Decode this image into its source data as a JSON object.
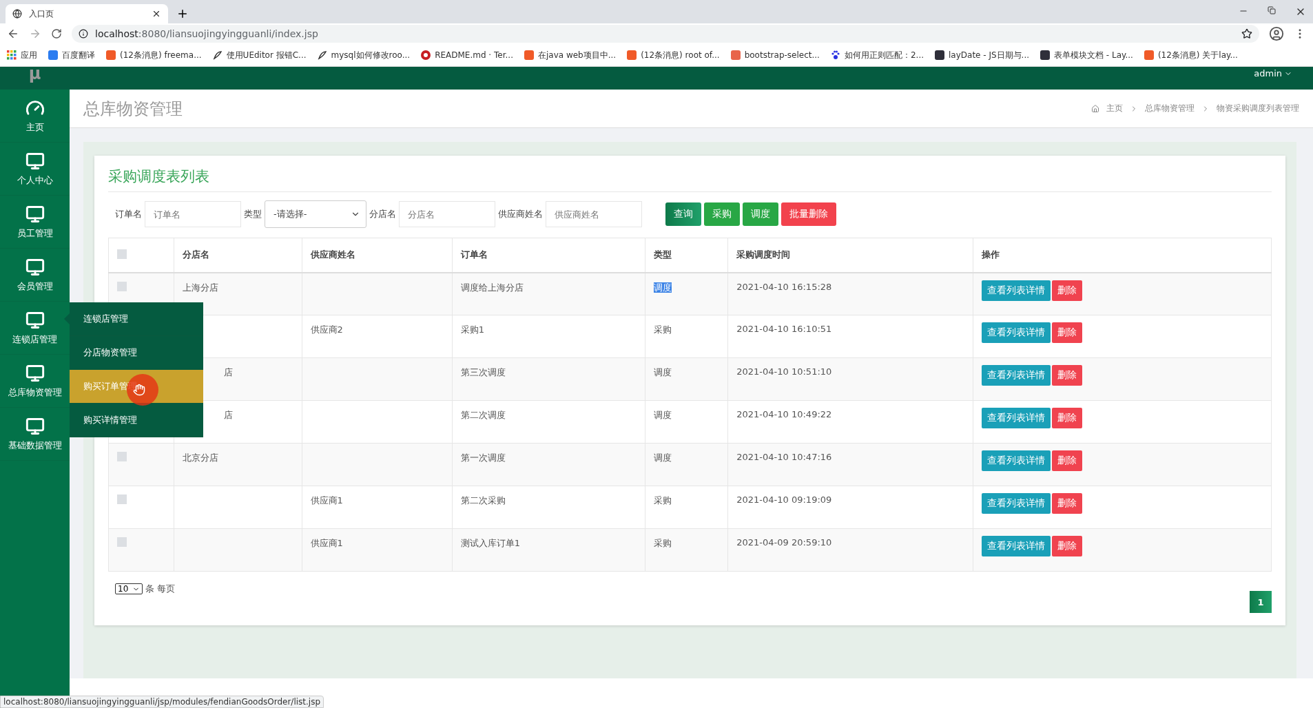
{
  "browser": {
    "tab_title": "入口页",
    "url_host": "localhost",
    "url_rest": ":8080/liansuojingyingguanli/index.jsp",
    "bookmarks": [
      {
        "kind": "apps",
        "label": "应用"
      },
      {
        "kind": "translate",
        "label": "百度翻译"
      },
      {
        "kind": "csdn",
        "label": "(12条消息) freema..."
      },
      {
        "kind": "feather",
        "label": "使用UEditor 报错C..."
      },
      {
        "kind": "feather",
        "label": "mysql如何修改roo..."
      },
      {
        "kind": "gitee",
        "label": "README.md · Ter..."
      },
      {
        "kind": "csdn",
        "label": "在java web项目中..."
      },
      {
        "kind": "csdn",
        "label": "(12条消息) root of..."
      },
      {
        "kind": "jian",
        "label": "bootstrap-select..."
      },
      {
        "kind": "paw",
        "label": "如何用正则匹配：2..."
      },
      {
        "kind": "layui",
        "label": "layDate - JS日期与..."
      },
      {
        "kind": "layui",
        "label": "表单模块文档 - Lay..."
      },
      {
        "kind": "csdn",
        "label": "(12条消息) 关于lay..."
      }
    ],
    "status_url": "localhost:8080/liansuojingyingguanli/jsp/modules/fendianGoodsOrder/list.jsp"
  },
  "header": {
    "logo": "μ",
    "user": "admin"
  },
  "sidebar": {
    "items": [
      {
        "kind": "dashboard",
        "label": "主页"
      },
      {
        "kind": "monitor",
        "label": "个人中心"
      },
      {
        "kind": "monitor",
        "label": "员工管理"
      },
      {
        "kind": "monitor",
        "label": "会员管理"
      },
      {
        "kind": "monitor",
        "label": "连锁店管理"
      },
      {
        "kind": "monitor",
        "label": "总库物资管理"
      },
      {
        "kind": "monitor",
        "label": "基础数据管理"
      }
    ]
  },
  "flyout": {
    "items": [
      {
        "label": "连锁店管理",
        "selected": false
      },
      {
        "label": "分店物资管理",
        "selected": false
      },
      {
        "label": "购买订单管理",
        "selected": true
      },
      {
        "label": "购买详情管理",
        "selected": false
      }
    ]
  },
  "page_title": "总库物资管理",
  "breadcrumb": [
    "主页",
    "总库物资管理",
    "物资采购调度列表管理"
  ],
  "card_title": "采购调度表列表",
  "filters": [
    {
      "kind": "input",
      "label": "订单名",
      "placeholder": "订单名"
    },
    {
      "kind": "select",
      "label": "类型",
      "value": "-请选择-"
    },
    {
      "kind": "input",
      "label": "分店名",
      "placeholder": "分店名"
    },
    {
      "kind": "input",
      "label": "供应商姓名",
      "placeholder": "供应商姓名"
    }
  ],
  "actions": [
    {
      "label": "查询",
      "kind": "search"
    },
    {
      "label": "采购",
      "kind": "green"
    },
    {
      "label": "调度",
      "kind": "green"
    },
    {
      "label": "批量删除",
      "kind": "danger"
    }
  ],
  "table": {
    "header_checked": false,
    "columns": [
      "分店名",
      "供应商姓名",
      "订单名",
      "类型",
      "采购调度时间",
      "操作"
    ],
    "rows": [
      {
        "checked": false,
        "shop": "上海分店",
        "supplier": "",
        "order": "调度给上海分店",
        "type": "调度",
        "type_highlighted": true,
        "time": "2021-04-10 16:15:28",
        "buttons": [
          "查看列表详情",
          "删除"
        ]
      },
      {
        "shop": "",
        "supplier": "供应商2",
        "order": "采购1",
        "type": "采购",
        "type_highlighted": false,
        "time": "2021-04-10 16:10:51",
        "buttons": [
          "查看列表详情",
          "删除"
        ]
      },
      {
        "shop": "店",
        "supplier": "",
        "order": "第三次调度",
        "type": "调度",
        "type_highlighted": false,
        "time": "2021-04-10 10:51:10",
        "buttons": [
          "查看列表详情",
          "删除"
        ]
      },
      {
        "shop": "店",
        "supplier": "",
        "order": "第二次调度",
        "type": "调度",
        "type_highlighted": false,
        "time": "2021-04-10 10:49:22",
        "buttons": [
          "查看列表详情",
          "删除"
        ]
      },
      {
        "checked": false,
        "shop": "北京分店",
        "supplier": "",
        "order": "第一次调度",
        "type": "调度",
        "type_highlighted": false,
        "time": "2021-04-10 10:47:16",
        "buttons": [
          "查看列表详情",
          "删除"
        ]
      },
      {
        "checked": false,
        "shop": "",
        "supplier": "供应商1",
        "order": "第二次采购",
        "type": "采购",
        "type_highlighted": false,
        "time": "2021-04-10 09:19:09",
        "buttons": [
          "查看列表详情",
          "删除"
        ]
      },
      {
        "checked": false,
        "shop": "",
        "supplier": "供应商1",
        "order": "测试入库订单1",
        "type": "采购",
        "type_highlighted": false,
        "time": "2021-04-09 20:59:10",
        "buttons": [
          "查看列表详情",
          "删除"
        ]
      }
    ]
  },
  "pager": {
    "page_size": "10",
    "page_size_suffix": "条 每页",
    "pages": [
      {
        "label": "1",
        "selected": true
      }
    ]
  }
}
